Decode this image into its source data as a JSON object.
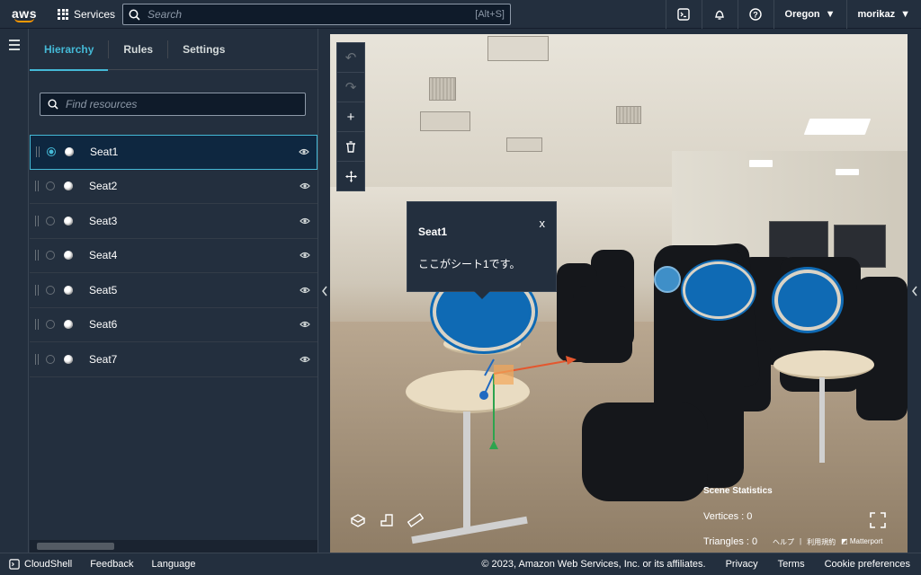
{
  "nav": {
    "logo": "aws",
    "services": "Services",
    "search_placeholder": "Search",
    "search_shortcut": "[Alt+S]",
    "region": "Oregon",
    "user": "morikaz"
  },
  "panel": {
    "tabs": [
      "Hierarchy",
      "Rules",
      "Settings"
    ],
    "active_tab": "Hierarchy",
    "filter_placeholder": "Find resources",
    "items": [
      {
        "label": "Seat1",
        "selected": true
      },
      {
        "label": "Seat2",
        "selected": false
      },
      {
        "label": "Seat3",
        "selected": false
      },
      {
        "label": "Seat4",
        "selected": false
      },
      {
        "label": "Seat5",
        "selected": false
      },
      {
        "label": "Seat6",
        "selected": false
      },
      {
        "label": "Seat7",
        "selected": false
      }
    ]
  },
  "viewport": {
    "tools": [
      "undo-icon",
      "redo-icon",
      "add-icon",
      "trash-icon",
      "move-icon"
    ],
    "popup": {
      "title": "Seat1",
      "close": "x",
      "body": "ここがシート1です。"
    },
    "stats": {
      "heading": "Scene Statistics",
      "vertices": "Vertices : 0",
      "triangles": "Triangles : 0"
    },
    "matterport": {
      "help": "ヘルプ",
      "sep": "|",
      "terms": "利用規約",
      "brand": "Matterport"
    },
    "accent": "#0f6ab4"
  },
  "footer": {
    "cloudshell": "CloudShell",
    "feedback": "Feedback",
    "language": "Language",
    "copyright": "© 2023, Amazon Web Services, Inc. or its affiliates.",
    "privacy": "Privacy",
    "terms": "Terms",
    "cookie": "Cookie preferences"
  }
}
